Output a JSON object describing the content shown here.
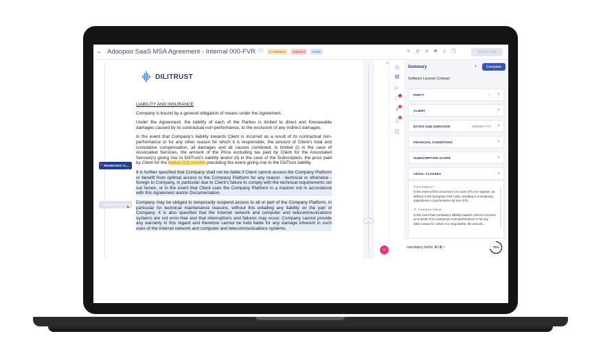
{
  "header": {
    "title": "Adoopoo SaaS MSA Agreement - Internal  000-FVR",
    "badges": [
      "In validation",
      "Rejected",
      "Active"
    ],
    "send_label": "Send or sign"
  },
  "document": {
    "logo_text": "DILITRUST",
    "heading": "LIABILITY AND INSURANCE",
    "p1": "Company is bound by a general obligation of means under the Agreement.",
    "p2": "Under the Agreement, the liability of each of the Parties is limited to direct and foreseeable damages caused by its contractual non-performance, to the exclusion of any indirect damages.",
    "p3_a": "In the event that Company's liability towards Client is incurred as a result of its contractual non-performance or for any other reason for which it is responsible, the amount of Client's total and cumulative compensation, all damages and all causes combined, is limited (i) in the case of Associated Services, the amount of the Price excluding tax paid by Client for the Associated Service(s) giving rise to DiliTrust's liability and/or (ii) in the case of the Subscription, the price paid by Client for the ",
    "p3_highlight": "twelve (12) months",
    "p3_b": " preceding the event giving rise to the DiliTrust liability.",
    "p4": "It is further specified that Company shall not be liable if Client cannot access the Company Platform or benefit from optimal access to the Company Platform for any reason - technical or otherwise - foreign to Company, in particular due to Client's failure to comply with the technical requirements set out herein, or in the event that Client uses the Company Platform in a manner not in accordance with this Agreement and/or Documentation.",
    "p5": "Company may be obliged to temporarily suspend access to all or part of the Company Platform, in particular for technical maintenance reasons, without this entailing any liability on the part of Company. It is also specified that the Internet network and computer and telecommunications systems are not error-free and that interruptions and failures may occur. Company cannot provide any warranty in this regard and therefore cannot be held liable for any damage inherent in such uses of the Internet network and computer and telecommunications systems.",
    "tag_insurance": "INSURANCE CL...",
    "tag_liability": "LIABILITY CLAUSE",
    "page_indicator": "15"
  },
  "rail": {
    "dot_1": "2",
    "dot_2": "6"
  },
  "summary": {
    "title": "Summary",
    "complete_label": "Complete",
    "subtitle": "Software License Contract",
    "sections": [
      {
        "label": "PARTY"
      },
      {
        "label": "CLIENT"
      },
      {
        "label": "DATES AND DURATION",
        "extra": "MM/DD/YYYY"
      },
      {
        "label": "FINANCIAL CONDITIONS"
      },
      {
        "label": "SUBSCRIPTION SCOPE"
      },
      {
        "label": "LEGAL CLAUSES"
      }
    ],
    "legal": {
      "item1_title": "Force Majeure *",
      "item1_body": "In the event of the occurrence of a case of fo rce majeure, as defined in the European Civil Code, resulting in a temporary impediment t o performance by one of th...",
      "item2_title": "Insurance Clause",
      "item2_body": "In the event that Company's liability towards Client is incurred as a result of its contractua l non-performance or for any other reason fo r which it is responsible, the amount..."
    },
    "mandatory_label": "mandatory fields",
    "mandatory_value": "8 / 8",
    "progress_text": "70%",
    "progress_value": 70
  },
  "colors": {
    "brand": "#3655b5",
    "accent_pink": "#e8327a",
    "alert_red": "#e22a3a",
    "highlight_yellow": "#fde28a"
  }
}
